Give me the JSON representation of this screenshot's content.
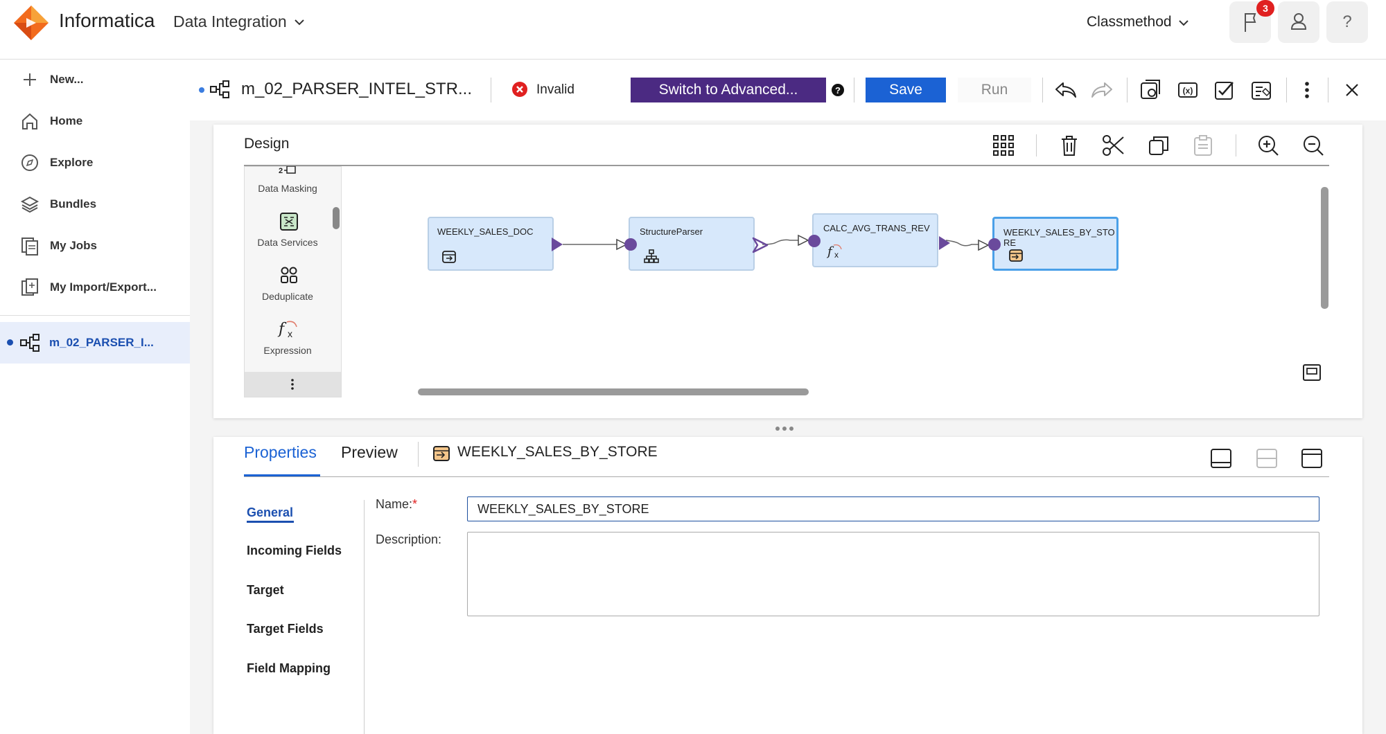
{
  "header": {
    "brand": "Informatica",
    "product": "Data Integration",
    "org": "Classmethod",
    "notifications_count": "3",
    "help": "?"
  },
  "sidebar": {
    "new_label": "New...",
    "items": [
      {
        "label": "Home",
        "icon": "home-icon"
      },
      {
        "label": "Explore",
        "icon": "compass-icon"
      },
      {
        "label": "Bundles",
        "icon": "layers-icon"
      },
      {
        "label": "My Jobs",
        "icon": "jobs-icon"
      },
      {
        "label": "My Import/Export..."
      }
    ],
    "open_asset": "m_02_PARSER_I..."
  },
  "toolbar": {
    "mapping_title": "m_02_PARSER_INTEL_STR...",
    "status": "Invalid",
    "advanced_label": "Switch to Advanced...",
    "save_label": "Save",
    "run_label": "Run"
  },
  "design": {
    "title": "Design",
    "palette": [
      "Data Masking",
      "Data Services",
      "Deduplicate",
      "Expression"
    ],
    "nodes": [
      {
        "label": "WEEKLY_SALES_DOC",
        "type": "source"
      },
      {
        "label": "StructureParser",
        "type": "structure-parser"
      },
      {
        "label": "CALC_AVG_TRANS_REV",
        "type": "expression"
      },
      {
        "label": "WEEKLY_SALES_BY_STO RE",
        "type": "target",
        "selected": true
      }
    ]
  },
  "properties": {
    "tabs": [
      "Properties",
      "Preview"
    ],
    "active_tab": "Properties",
    "selected_object": "WEEKLY_SALES_BY_STORE",
    "nav": [
      "General",
      "Incoming Fields",
      "Target",
      "Target Fields",
      "Field Mapping"
    ],
    "active_nav": "General",
    "name_label": "Name:",
    "required_marker": "*",
    "name_value": "WEEKLY_SALES_BY_STORE",
    "description_label": "Description:",
    "description_value": ""
  },
  "colors": {
    "accent_blue": "#1b62d4",
    "advanced_purple": "#4b2a82",
    "error_red": "#e02020",
    "node_fill": "#d7e8fb",
    "port_purple": "#6a4a9c"
  }
}
